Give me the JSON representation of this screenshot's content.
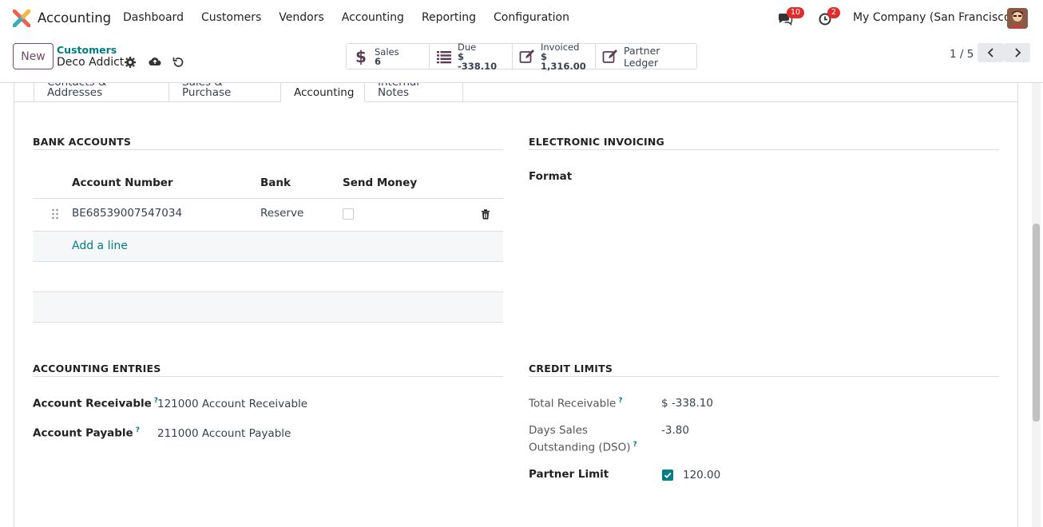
{
  "app": {
    "name": "Accounting"
  },
  "nav": {
    "items": [
      "Dashboard",
      "Customers",
      "Vendors",
      "Accounting",
      "Reporting",
      "Configuration"
    ]
  },
  "systray": {
    "messages_count": "10",
    "activities_count": "2",
    "company": "My Company (San Francisco)"
  },
  "control": {
    "new_label": "New",
    "breadcrumb_parent": "Customers",
    "breadcrumb_current": "Deco Addict",
    "pager": "1 / 5"
  },
  "stats": {
    "sales_label": "Sales",
    "sales_value": "6",
    "due_label": "Due",
    "due_value": "$ -338.10",
    "invoiced_label": "Invoiced",
    "invoiced_value": "$ 1,316.00",
    "ledger_label": "Partner Ledger"
  },
  "tabs": [
    "Contacts & Addresses",
    "Sales & Purchase",
    "Accounting",
    "Internal Notes"
  ],
  "bank": {
    "title": "BANK ACCOUNTS",
    "col_account": "Account Number",
    "col_bank": "Bank",
    "col_send": "Send Money",
    "row_account": "BE68539007547034",
    "row_bank": "Reserve",
    "row_send_money": false,
    "add_line": "Add a line"
  },
  "einvoice": {
    "title": "ELECTRONIC INVOICING",
    "format_label": "Format"
  },
  "entries": {
    "title": "ACCOUNTING ENTRIES",
    "receivable_label": "Account Receivable",
    "receivable_value": "121000 Account Receivable",
    "payable_label": "Account Payable",
    "payable_value": "211000 Account Payable"
  },
  "credit": {
    "title": "CREDIT LIMITS",
    "total_label": "Total Receivable",
    "total_value": "$ -338.10",
    "dso_label_1": "Days Sales",
    "dso_label_2": "Outstanding (DSO)",
    "dso_value": "-3.80",
    "limit_label": "Partner Limit",
    "limit_checked": true,
    "limit_value": "120.00"
  },
  "tooltip_mark": "?",
  "colors": {
    "brand": "#714b67",
    "accent": "#017e84",
    "badge": "#e02c2c"
  }
}
